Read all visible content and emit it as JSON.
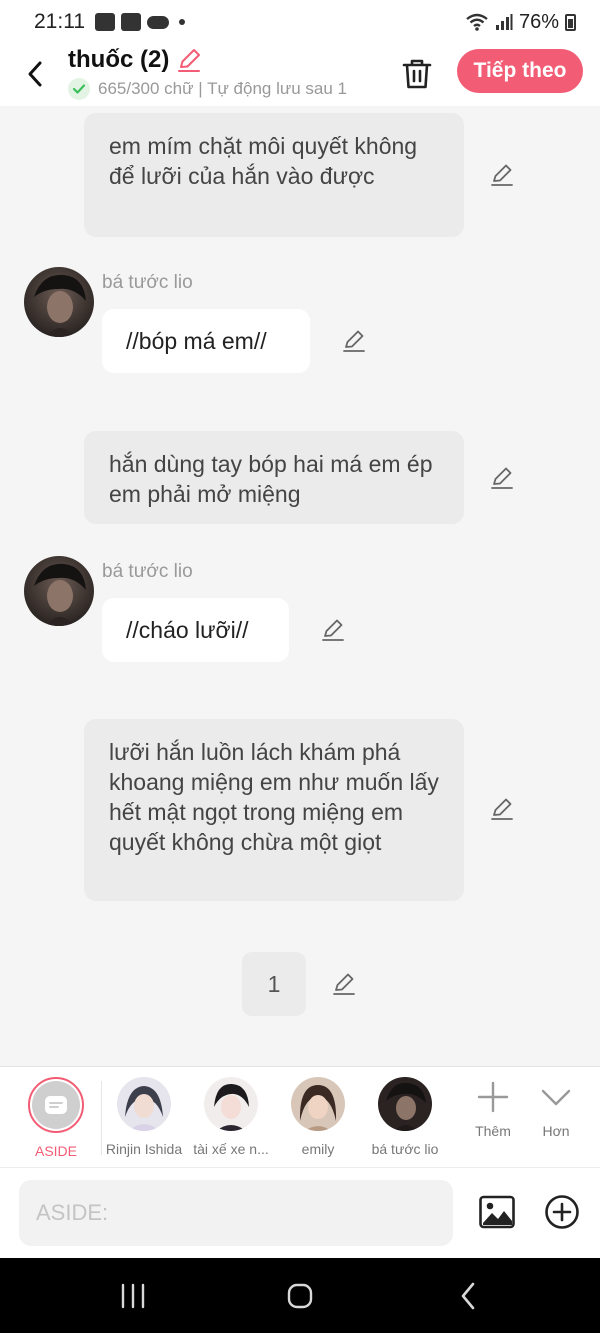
{
  "status_bar": {
    "time": "21:11",
    "battery": "76%"
  },
  "header": {
    "title": "thuốc (2)",
    "subtitle": "665/300 chữ | Tự động lưu sau 1",
    "next_label": "Tiếp theo"
  },
  "messages": {
    "narration_1": "em mím chặt môi quyết không để lưỡi của hắn vào được",
    "speaker_1": "bá tước lio",
    "dialog_1": "//bóp má em//",
    "narration_2": "hắn dùng tay bóp hai má em ép em phải mở miệng",
    "speaker_2": "bá tước lio",
    "dialog_2": "//cháo lưỡi//",
    "narration_3": "lưỡi hắn luồn lách khám phá khoang miệng em như muốn lấy hết mật ngọt trong miệng em quyết không chừa một giọt",
    "page_number": "1"
  },
  "characters": [
    {
      "label": "ASIDE"
    },
    {
      "label": "Rinjin Ishida"
    },
    {
      "label": "tài xế xe n..."
    },
    {
      "label": "emily"
    },
    {
      "label": "bá tước lio"
    }
  ],
  "tools": {
    "more_label": "Thêm",
    "expand_label": "Hơn"
  },
  "input": {
    "placeholder": "ASIDE:"
  },
  "colors": {
    "accent": "#f25c74",
    "narration_bg": "#ebebeb",
    "background": "#f5f5f5"
  }
}
